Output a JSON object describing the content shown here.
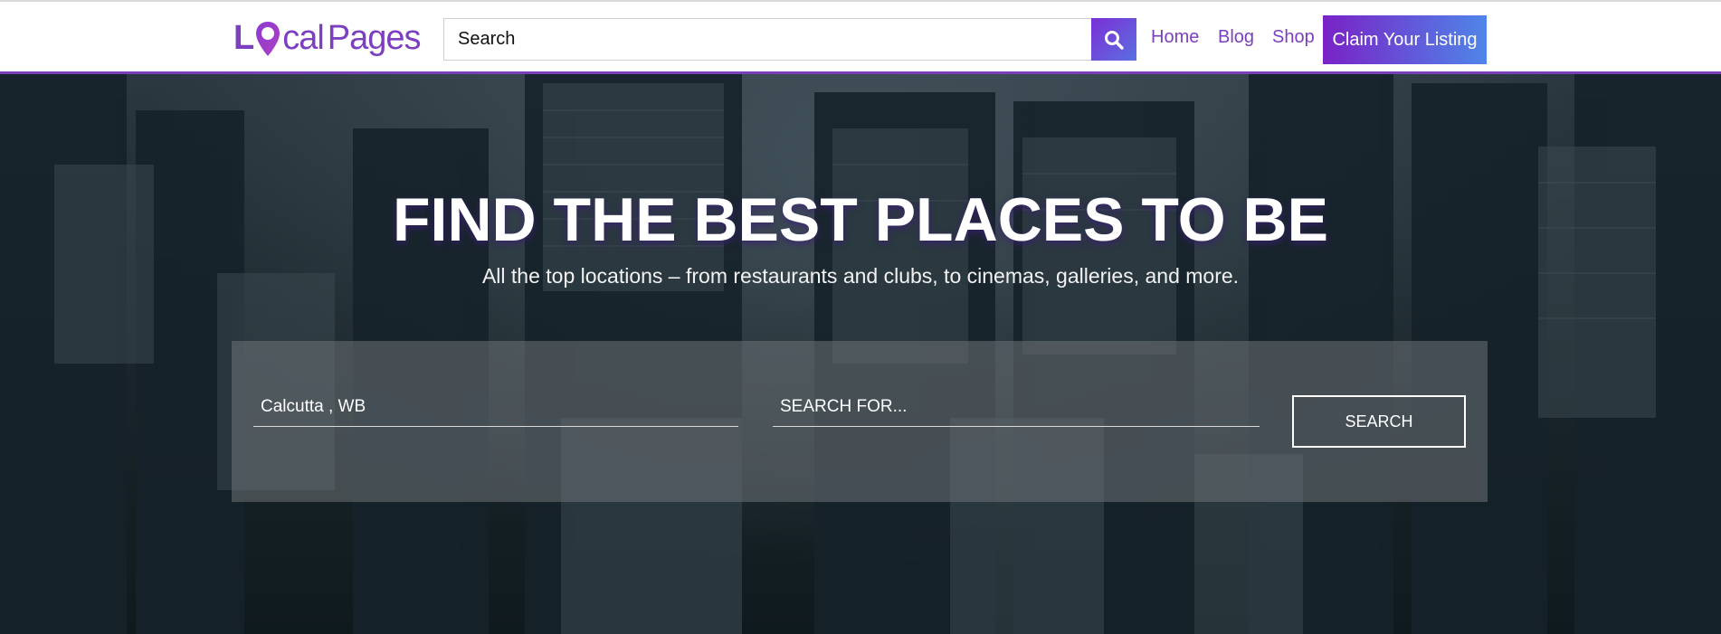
{
  "header": {
    "logo": {
      "first": "L",
      "middle": "cal",
      "second": "Pages"
    },
    "search": {
      "placeholder": "Search"
    },
    "nav": [
      {
        "label": "Home"
      },
      {
        "label": "Blog"
      },
      {
        "label": "Shop"
      }
    ],
    "cta_label": "Claim Your Listing"
  },
  "hero": {
    "title": "FIND THE BEST PLACES TO BE",
    "subtitle": "All the top locations – from restaurants and clubs, to cinemas, galleries, and more.",
    "location_value": "Calcutta , WB",
    "search_for_placeholder": "SEARCH FOR...",
    "search_button_label": "SEARCH"
  },
  "colors": {
    "brand": "#7b3fc0",
    "header_border": "#7b3fb8",
    "cta_gradient_start": "#7a22c6",
    "cta_gradient_end": "#4e86e8"
  },
  "icons": {
    "search_button": "search-icon",
    "logo_pin": "map-pin-icon"
  }
}
